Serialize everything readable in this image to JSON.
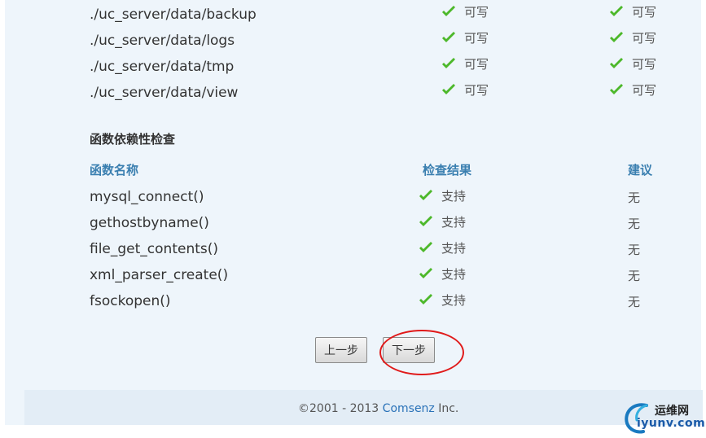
{
  "dirs": [
    {
      "path": "./uc_server/data/backup",
      "current": "可写",
      "required": "可写"
    },
    {
      "path": "./uc_server/data/logs",
      "current": "可写",
      "required": "可写"
    },
    {
      "path": "./uc_server/data/tmp",
      "current": "可写",
      "required": "可写"
    },
    {
      "path": "./uc_server/data/view",
      "current": "可写",
      "required": "可写"
    }
  ],
  "func_check": {
    "title": "函数依赖性检查",
    "headers": {
      "name": "函数名称",
      "result": "检查结果",
      "suggest": "建议"
    },
    "rows": [
      {
        "name": "mysql_connect()",
        "result": "支持",
        "suggest": "无"
      },
      {
        "name": "gethostbyname()",
        "result": "支持",
        "suggest": "无"
      },
      {
        "name": "file_get_contents()",
        "result": "支持",
        "suggest": "无"
      },
      {
        "name": "xml_parser_create()",
        "result": "支持",
        "suggest": "无"
      },
      {
        "name": "fsockopen()",
        "result": "支持",
        "suggest": "无"
      }
    ]
  },
  "buttons": {
    "prev": "上一步",
    "next": "下一步"
  },
  "footer": {
    "copyright": "©2001 - 2013",
    "brand": "Comsenz",
    "suffix": "Inc."
  },
  "watermark": {
    "cn": "运维网",
    "en": "iyunv.com"
  },
  "colors": {
    "check": "#4cb82a",
    "header": "#3a7fb0",
    "annotation": "#e01a1a",
    "brand": "#2a72b8"
  }
}
